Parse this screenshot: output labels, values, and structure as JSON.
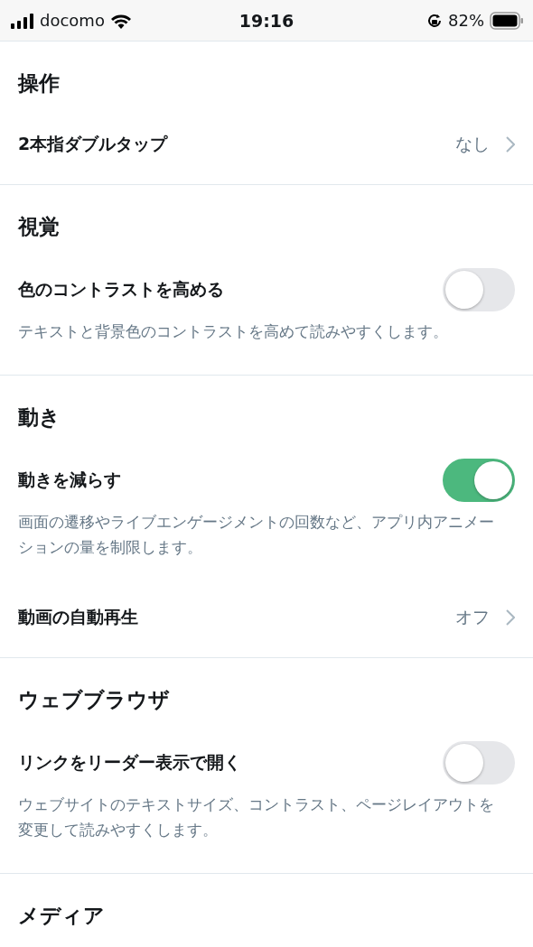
{
  "status_bar": {
    "carrier": "docomo",
    "time": "19:16",
    "battery": "82%"
  },
  "sections": [
    {
      "title": "操作",
      "items": [
        {
          "kind": "nav",
          "label": "2本指ダブルタップ",
          "value": "なし"
        }
      ]
    },
    {
      "title": "視覚",
      "items": [
        {
          "kind": "toggle",
          "label": "色のコントラストを高める",
          "on": false,
          "description": "テキストと背景色のコントラストを高めて読みやすくします。"
        }
      ]
    },
    {
      "title": "動き",
      "items": [
        {
          "kind": "toggle",
          "label": "動きを減らす",
          "on": true,
          "description": "画面の遷移やライブエンゲージメントの回数など、アプリ内アニメーションの量を制限します。"
        },
        {
          "kind": "nav",
          "label": "動画の自動再生",
          "value": "オフ"
        }
      ]
    },
    {
      "title": "ウェブブラウザ",
      "items": [
        {
          "kind": "toggle",
          "label": "リンクをリーダー表示で開く",
          "on": false,
          "description": "ウェブサイトのテキストサイズ、コントラスト、ページレイアウトを変更して読みやすくします。"
        }
      ]
    },
    {
      "title": "メディア"
    }
  ]
}
